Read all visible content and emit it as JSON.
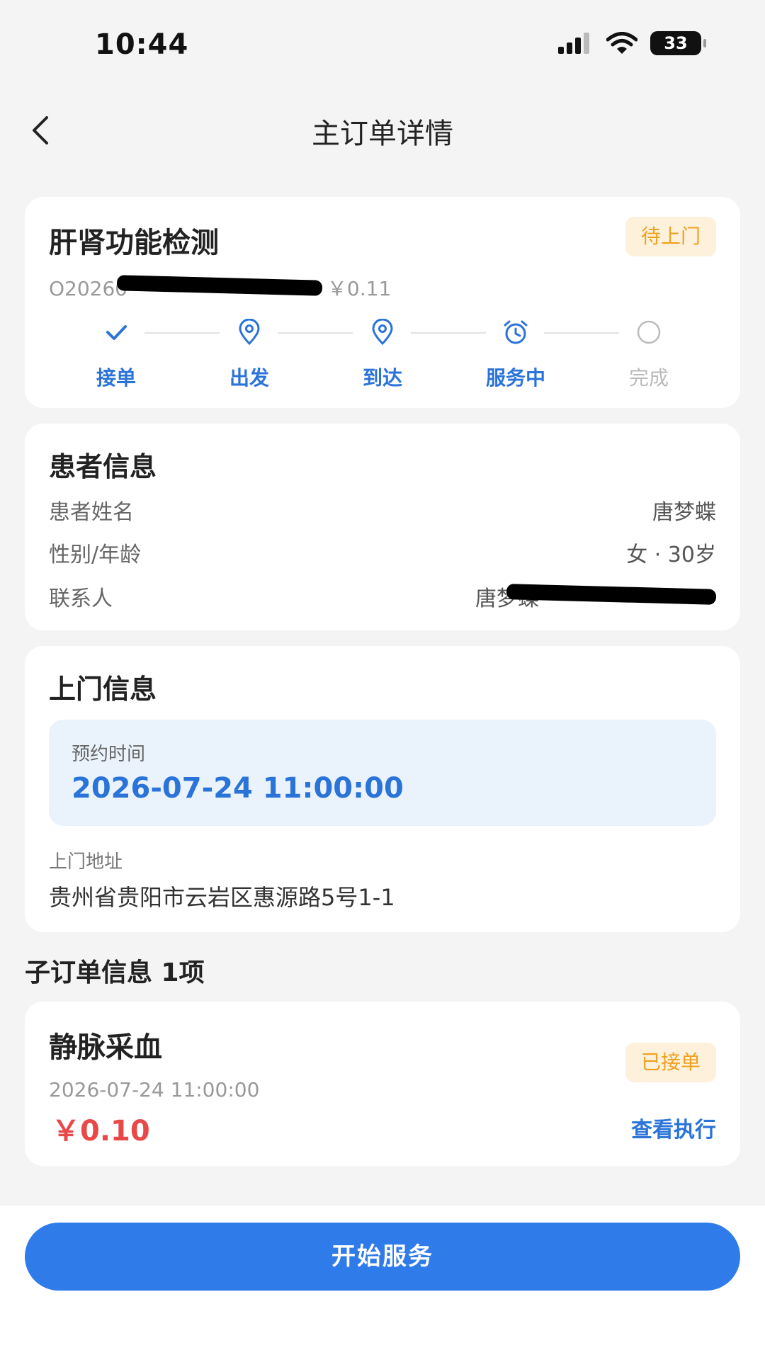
{
  "status_bar": {
    "time": "10:44",
    "battery": "33"
  },
  "nav": {
    "title": "主订单详情"
  },
  "order": {
    "title": "肝肾功能检测",
    "status_badge": "待上门",
    "order_no_prefix": "O20260",
    "order_no_suffix": "· ￥0.11",
    "steps": [
      {
        "label": "接单",
        "icon": "check-icon",
        "done": true
      },
      {
        "label": "出发",
        "icon": "location-pin-icon",
        "done": true
      },
      {
        "label": "到达",
        "icon": "location-pin-icon",
        "done": true
      },
      {
        "label": "服务中",
        "icon": "alarm-clock-icon",
        "done": true
      },
      {
        "label": "完成",
        "icon": "empty-circle-icon",
        "done": false
      }
    ]
  },
  "patient": {
    "section_title": "患者信息",
    "name_label": "患者姓名",
    "name_value": "唐梦蝶",
    "gender_age_label": "性别/年龄",
    "gender_age_value": "女 · 30岁",
    "contact_label": "联系人",
    "contact_value": "唐梦蝶"
  },
  "visit": {
    "section_title": "上门信息",
    "appointment_label": "预约时间",
    "appointment_time": "2026-07-24 11:00:00",
    "address_label": "上门地址",
    "address_value": "贵州省贵阳市云岩区惠源路5号1-1"
  },
  "sub_orders": {
    "header": "子订单信息 1项",
    "items": [
      {
        "title": "静脉采血",
        "status_badge": "已接单",
        "time": "2026-07-24 11:00:00",
        "price": "￥0.10",
        "action": "查看执行"
      }
    ]
  },
  "footer": {
    "start_button": "开始服务"
  },
  "colors": {
    "primary": "#2f7bea",
    "link": "#2a73d8",
    "price": "#e84848",
    "badge_text": "#f0a020",
    "badge_bg": "#fdf1dc"
  }
}
